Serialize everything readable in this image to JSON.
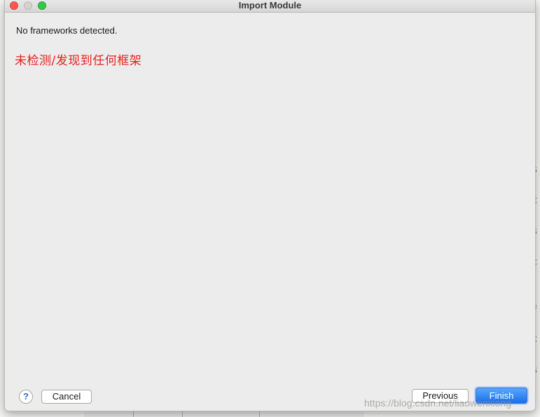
{
  "window": {
    "title": "Import Module"
  },
  "content": {
    "message": "No frameworks detected.",
    "annotation": "未检测/发现到任何框架"
  },
  "buttons": {
    "help": "?",
    "cancel": "Cancel",
    "previous": "Previous",
    "finish": "Finish"
  },
  "watermark": "https://blog.csdn.net/liaowenxiong",
  "colors": {
    "annotation": "#e8201b",
    "finish_button": "#1a6fe8",
    "close_light": "#fc5753",
    "minimize_light": "#d5d4cc",
    "maximize_light": "#34c748"
  }
}
